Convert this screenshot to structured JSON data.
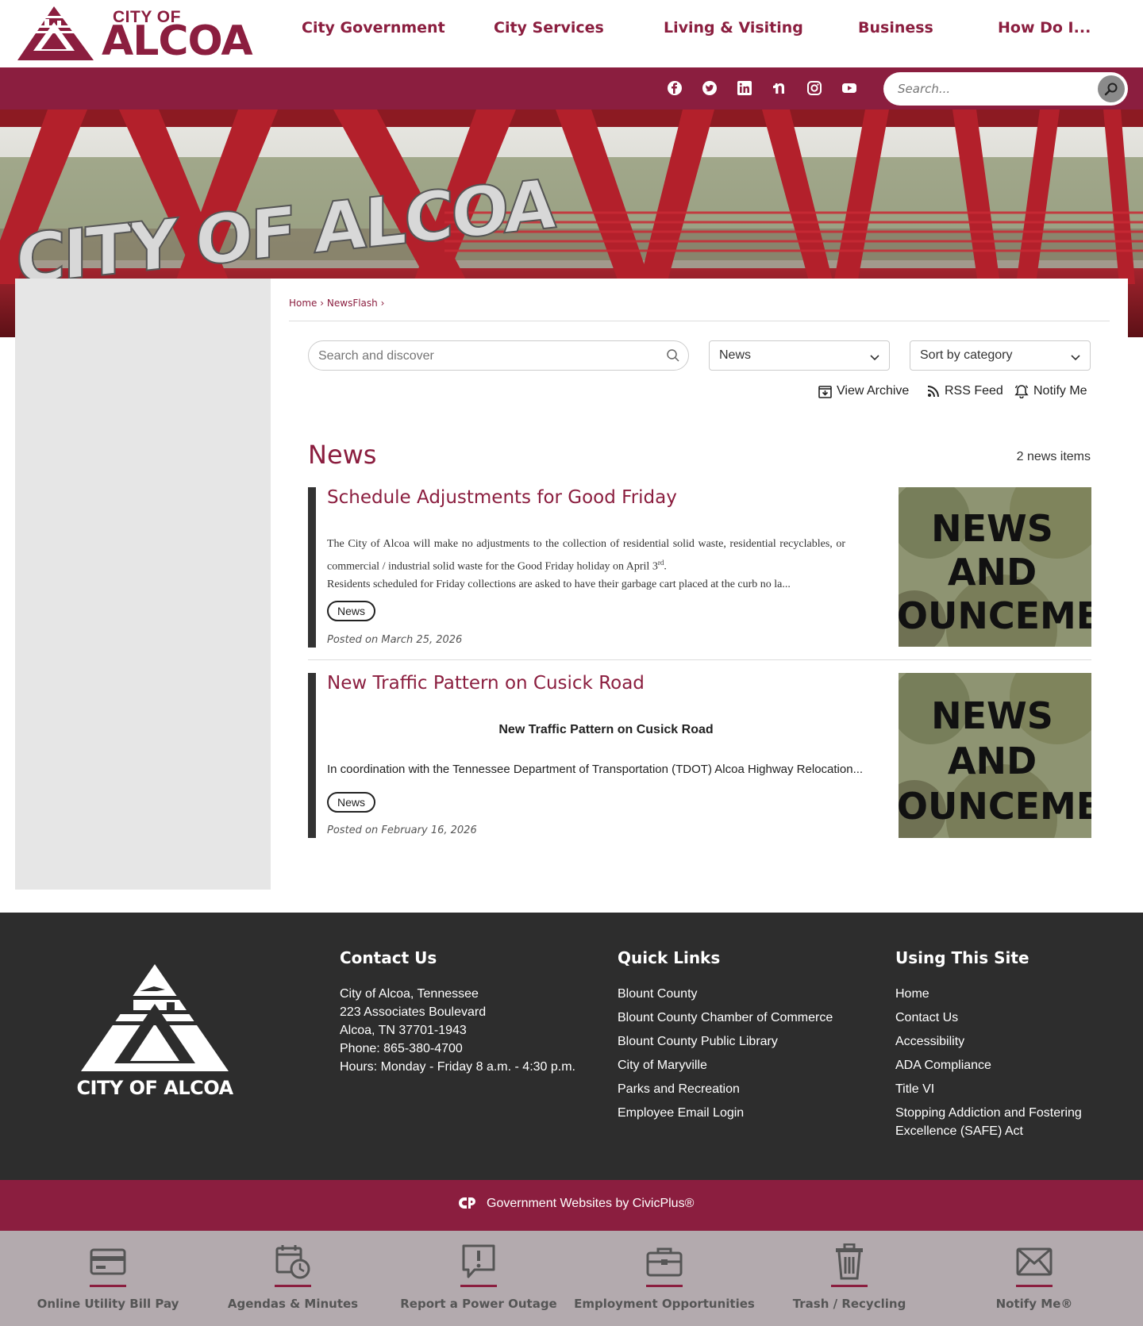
{
  "header": {
    "logo": {
      "line1": "CITY OF",
      "line2": "ALCOA"
    },
    "nav": [
      "City Government",
      "City Services",
      "Living & Visiting",
      "Business",
      "How Do I..."
    ],
    "social_icons": [
      "facebook-icon",
      "twitter-icon",
      "linkedin-icon",
      "nextdoor-icon",
      "instagram-icon",
      "youtube-icon"
    ],
    "search": {
      "placeholder": "Search..."
    }
  },
  "hero": {
    "sign_text": "CITY OF ALCOA"
  },
  "breadcrumb": {
    "home": "Home",
    "section": "NewsFlash"
  },
  "filters": {
    "search_placeholder": "Search and discover",
    "category_value": "News",
    "sort_value": "Sort by category"
  },
  "actions": {
    "archive": "View Archive",
    "rss": "RSS Feed",
    "notify": "Notify Me"
  },
  "news": {
    "heading": "News",
    "count": "2 news items",
    "items": [
      {
        "title": "Schedule Adjustments for Good Friday",
        "body_p1": "The City of Alcoa will make no adjustments to the collection of residential solid waste, residential recyclables, or commercial / industrial solid waste for the Good Friday holiday on April 3",
        "body_p1_sup": "rd",
        "body_p2": "Residents scheduled for Friday collections are asked to have their garbage cart placed at the curb no la...",
        "tag": "News",
        "posted": "Posted on March 25, 2026",
        "thumb_text": [
          "NEWS",
          "AND",
          "IOUNCEME"
        ]
      },
      {
        "title": "New Traffic Pattern on Cusick Road",
        "subhead": "New Traffic Pattern on Cusick Road",
        "body": "In coordination with the Tennessee Department of Transportation (TDOT) Alcoa Highway Relocation...",
        "tag": "News",
        "posted": "Posted on February 16, 2026",
        "thumb_text": [
          "NEWS",
          "AND",
          "IOUNCEME"
        ]
      }
    ]
  },
  "footer": {
    "logo_caption": "CITY OF ALCOA",
    "contact": {
      "heading": "Contact Us",
      "lines": [
        "City of Alcoa, Tennessee",
        "223 Associates Boulevard",
        "Alcoa, TN 37701-1943",
        "Phone: 865-380-4700",
        "Hours: Monday - Friday 8 a.m. - 4:30 p.m."
      ]
    },
    "quick_links": {
      "heading": "Quick Links",
      "links": [
        "Blount County",
        "Blount County Chamber of Commerce",
        "Blount County Public Library",
        "City of Maryville",
        "Parks and Recreation",
        "Employee Email Login"
      ]
    },
    "using_site": {
      "heading": "Using This Site",
      "links": [
        "Home",
        "Contact Us",
        "Accessibility",
        "ADA Compliance",
        "Title VI",
        "Stopping Addiction and Fostering Excellence (SAFE) Act"
      ]
    },
    "civicplus": "Government Websites by CivicPlus®"
  },
  "quickbar": [
    {
      "label": "Online Utility Bill Pay",
      "icon": "credit-card-icon"
    },
    {
      "label": "Agendas & Minutes",
      "icon": "calendar-clock-icon"
    },
    {
      "label": "Report a Power Outage",
      "icon": "alert-message-icon"
    },
    {
      "label": "Employment Opportunities",
      "icon": "briefcase-icon"
    },
    {
      "label": "Trash / Recycling",
      "icon": "trash-icon"
    },
    {
      "label": "Notify Me®",
      "icon": "envelope-icon"
    }
  ],
  "colors": {
    "brand": "#8b1e3f",
    "footer_bg": "#2d2d2d",
    "quickbar_bg": "#b3aaae"
  }
}
